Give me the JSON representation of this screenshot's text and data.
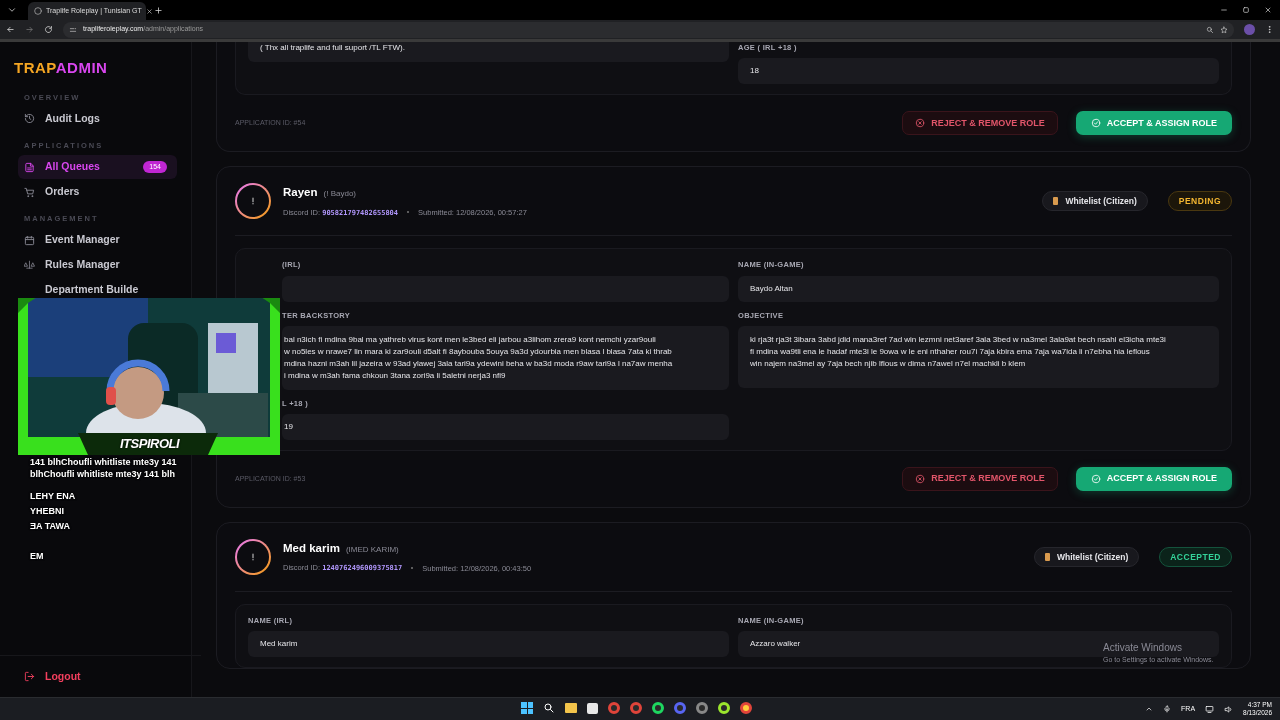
{
  "browser": {
    "tab_title": "Traplife Roleplay | Tunisian GT",
    "url_host": "trapliferoleplay.com",
    "url_path": "/admin/applications"
  },
  "sidebar": {
    "logo": {
      "first": "TRAP",
      "second": "ADMIN"
    },
    "sections": [
      {
        "heading": "OVERVIEW",
        "items": [
          {
            "label": "Audit Logs",
            "selected": false
          }
        ]
      },
      {
        "heading": "APPLICATIONS",
        "items": [
          {
            "label": "All Queues",
            "selected": true,
            "badge": "154"
          },
          {
            "label": "Orders",
            "selected": false
          }
        ]
      },
      {
        "heading": "MANAGEMENT",
        "items": [
          {
            "label": "Event Manager",
            "selected": false
          },
          {
            "label": "Rules Manager",
            "selected": false
          },
          {
            "label": "Department Builde",
            "selected": false
          }
        ]
      }
    ],
    "logout": "Logout"
  },
  "applications": [
    {
      "fields": [
        {
          "value": "( Thx all traplife and full suport /TL FTW)."
        },
        {
          "label": "AGE ( IRL +18 )",
          "value": "18"
        }
      ],
      "application_id": "APPLICATION ID: #54",
      "reject": "REJECT & REMOVE ROLE",
      "accept": "ACCEPT & ASSIGN ROLE"
    },
    {
      "name": "Rayen",
      "alias": "(! Baydo)",
      "discord_label": "Discord ID:",
      "discord_id": "905821797482655804",
      "submitted": "Submitted: 12/08/2026, 00:57:27",
      "category": "Whitelist (Citizen)",
      "status": "PENDING",
      "kind": "pending",
      "fields": [
        {
          "label": "(IRL)"
        },
        {
          "label": "NAME (IN-GAME)",
          "value": "Baydo Altan"
        },
        {
          "label": "TER BACKSTORY",
          "value": "bal n3ich fi mdina 9bal ma yathreb virus kont men le3bed eli jarbou a3lihom zrera9 kont nemchi yzar9ouli\nw no5les w nrawe7 lin mara ki zar9ouli d5alt fi 8aybouba 5ouya 9a3d ydourbia men blasa l blasa  7ata ki thrab\nmdina hazni m3ah lil jazeira w 93ad ylawej 3ala tari9a ydewini beha w ba3d moda r9aw tari9a l na7aw menha\ni mdina w m3ah fama chkoun 3tana zori9a li 5aletni nerja3 nfi9"
        },
        {
          "label": "OBJECTIVE",
          "value": "ki rja3t rja3t 3ibara 3abd jdid mana3ref 7ad win lezmni net3aref 3ala 3bed w na3mel 3ala9at bech nsahl el3icha mte3i\nfi mdina wa9tli ena le hadaf mte3i le 9owa  w le eni nthaher rou7i 7aja kbira  ema 7aja wa7ida li n7ebha hia leflous\nwin najem na3mel ay 7aja bech njib lflous w dima n7awel n7el machkli b klem"
        },
        {
          "label": "L +18 )",
          "value": "19"
        }
      ],
      "application_id": "APPLICATION ID: #53",
      "reject": "REJECT & REMOVE ROLE",
      "accept": "ACCEPT & ASSIGN ROLE"
    },
    {
      "name": "Med karim",
      "alias": "(IMED KARIM)",
      "discord_label": "Discord ID:",
      "discord_id": "1240762496009375817",
      "submitted": "Submitted: 12/08/2026, 00:43:50",
      "category": "Whitelist (Citizen)",
      "status": "ACCEPTED",
      "kind": "accepted",
      "fields": [
        {
          "label": "NAME (IRL)",
          "value": "Med karim"
        },
        {
          "label": "NAME (IN-GAME)",
          "value": "Azzaro walker"
        }
      ]
    }
  ],
  "stream_overlay": {
    "streamer": "ITSPIROLI",
    "chat": [
      "141 blhChoufli whitliste mte3y 141",
      "blhChoufli whitliste mte3y 141 blh",
      "LEHY ENA",
      "YHEBNI",
      "ƎA TAWA",
      "EM"
    ]
  },
  "activation": {
    "title": "Activate Windows",
    "hint": "Go to Settings to activate Windows."
  },
  "taskbar": {
    "language": "FRA",
    "time": "4:37 PM",
    "date": "8/13/2026"
  }
}
